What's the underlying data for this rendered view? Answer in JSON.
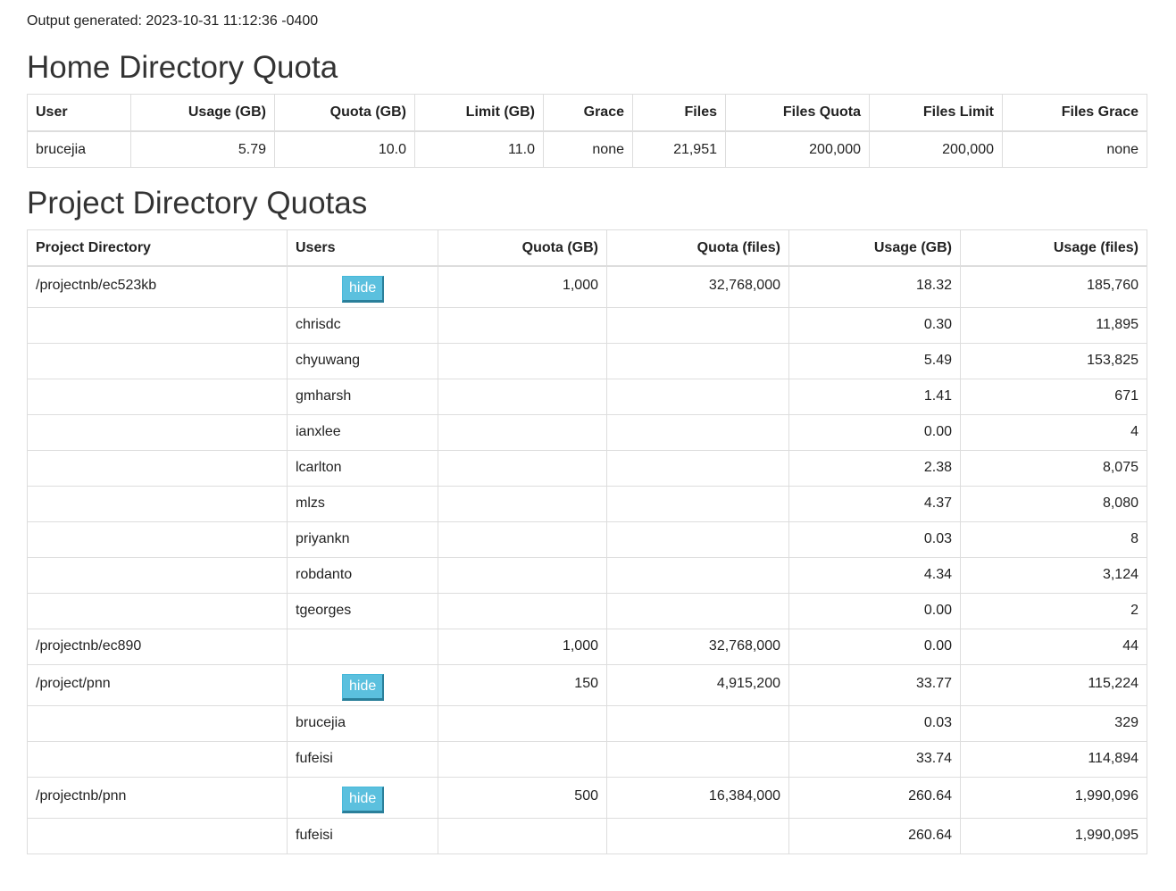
{
  "generated": "Output generated: 2023-10-31 11:12:36 -0400",
  "home": {
    "title": "Home Directory Quota",
    "headers": [
      "User",
      "Usage (GB)",
      "Quota (GB)",
      "Limit (GB)",
      "Grace",
      "Files",
      "Files Quota",
      "Files Limit",
      "Files Grace"
    ],
    "row": [
      "brucejia",
      "5.79",
      "10.0",
      "11.0",
      "none",
      "21,951",
      "200,000",
      "200,000",
      "none"
    ]
  },
  "project": {
    "title": "Project Directory Quotas",
    "headers": [
      "Project Directory",
      "Users",
      "Quota (GB)",
      "Quota (files)",
      "Usage (GB)",
      "Usage (files)"
    ],
    "hide_label": "hide",
    "rows": [
      {
        "dir": "/projectnb/ec523kb",
        "user": "",
        "hide": true,
        "quota_gb": "1,000",
        "quota_files": "32,768,000",
        "usage_gb": "18.32",
        "usage_files": "185,760"
      },
      {
        "dir": "",
        "user": "chrisdc",
        "hide": false,
        "quota_gb": "",
        "quota_files": "",
        "usage_gb": "0.30",
        "usage_files": "11,895"
      },
      {
        "dir": "",
        "user": "chyuwang",
        "hide": false,
        "quota_gb": "",
        "quota_files": "",
        "usage_gb": "5.49",
        "usage_files": "153,825"
      },
      {
        "dir": "",
        "user": "gmharsh",
        "hide": false,
        "quota_gb": "",
        "quota_files": "",
        "usage_gb": "1.41",
        "usage_files": "671"
      },
      {
        "dir": "",
        "user": "ianxlee",
        "hide": false,
        "quota_gb": "",
        "quota_files": "",
        "usage_gb": "0.00",
        "usage_files": "4"
      },
      {
        "dir": "",
        "user": "lcarlton",
        "hide": false,
        "quota_gb": "",
        "quota_files": "",
        "usage_gb": "2.38",
        "usage_files": "8,075"
      },
      {
        "dir": "",
        "user": "mlzs",
        "hide": false,
        "quota_gb": "",
        "quota_files": "",
        "usage_gb": "4.37",
        "usage_files": "8,080"
      },
      {
        "dir": "",
        "user": "priyankn",
        "hide": false,
        "quota_gb": "",
        "quota_files": "",
        "usage_gb": "0.03",
        "usage_files": "8"
      },
      {
        "dir": "",
        "user": "robdanto",
        "hide": false,
        "quota_gb": "",
        "quota_files": "",
        "usage_gb": "4.34",
        "usage_files": "3,124"
      },
      {
        "dir": "",
        "user": "tgeorges",
        "hide": false,
        "quota_gb": "",
        "quota_files": "",
        "usage_gb": "0.00",
        "usage_files": "2"
      },
      {
        "dir": "/projectnb/ec890",
        "user": "",
        "hide": false,
        "quota_gb": "1,000",
        "quota_files": "32,768,000",
        "usage_gb": "0.00",
        "usage_files": "44"
      },
      {
        "dir": "/project/pnn",
        "user": "",
        "hide": true,
        "quota_gb": "150",
        "quota_files": "4,915,200",
        "usage_gb": "33.77",
        "usage_files": "115,224"
      },
      {
        "dir": "",
        "user": "brucejia",
        "hide": false,
        "quota_gb": "",
        "quota_files": "",
        "usage_gb": "0.03",
        "usage_files": "329"
      },
      {
        "dir": "",
        "user": "fufeisi",
        "hide": false,
        "quota_gb": "",
        "quota_files": "",
        "usage_gb": "33.74",
        "usage_files": "114,894"
      },
      {
        "dir": "/projectnb/pnn",
        "user": "",
        "hide": true,
        "quota_gb": "500",
        "quota_files": "16,384,000",
        "usage_gb": "260.64",
        "usage_files": "1,990,096"
      },
      {
        "dir": "",
        "user": "fufeisi",
        "hide": false,
        "quota_gb": "",
        "quota_files": "",
        "usage_gb": "260.64",
        "usage_files": "1,990,095"
      }
    ]
  }
}
